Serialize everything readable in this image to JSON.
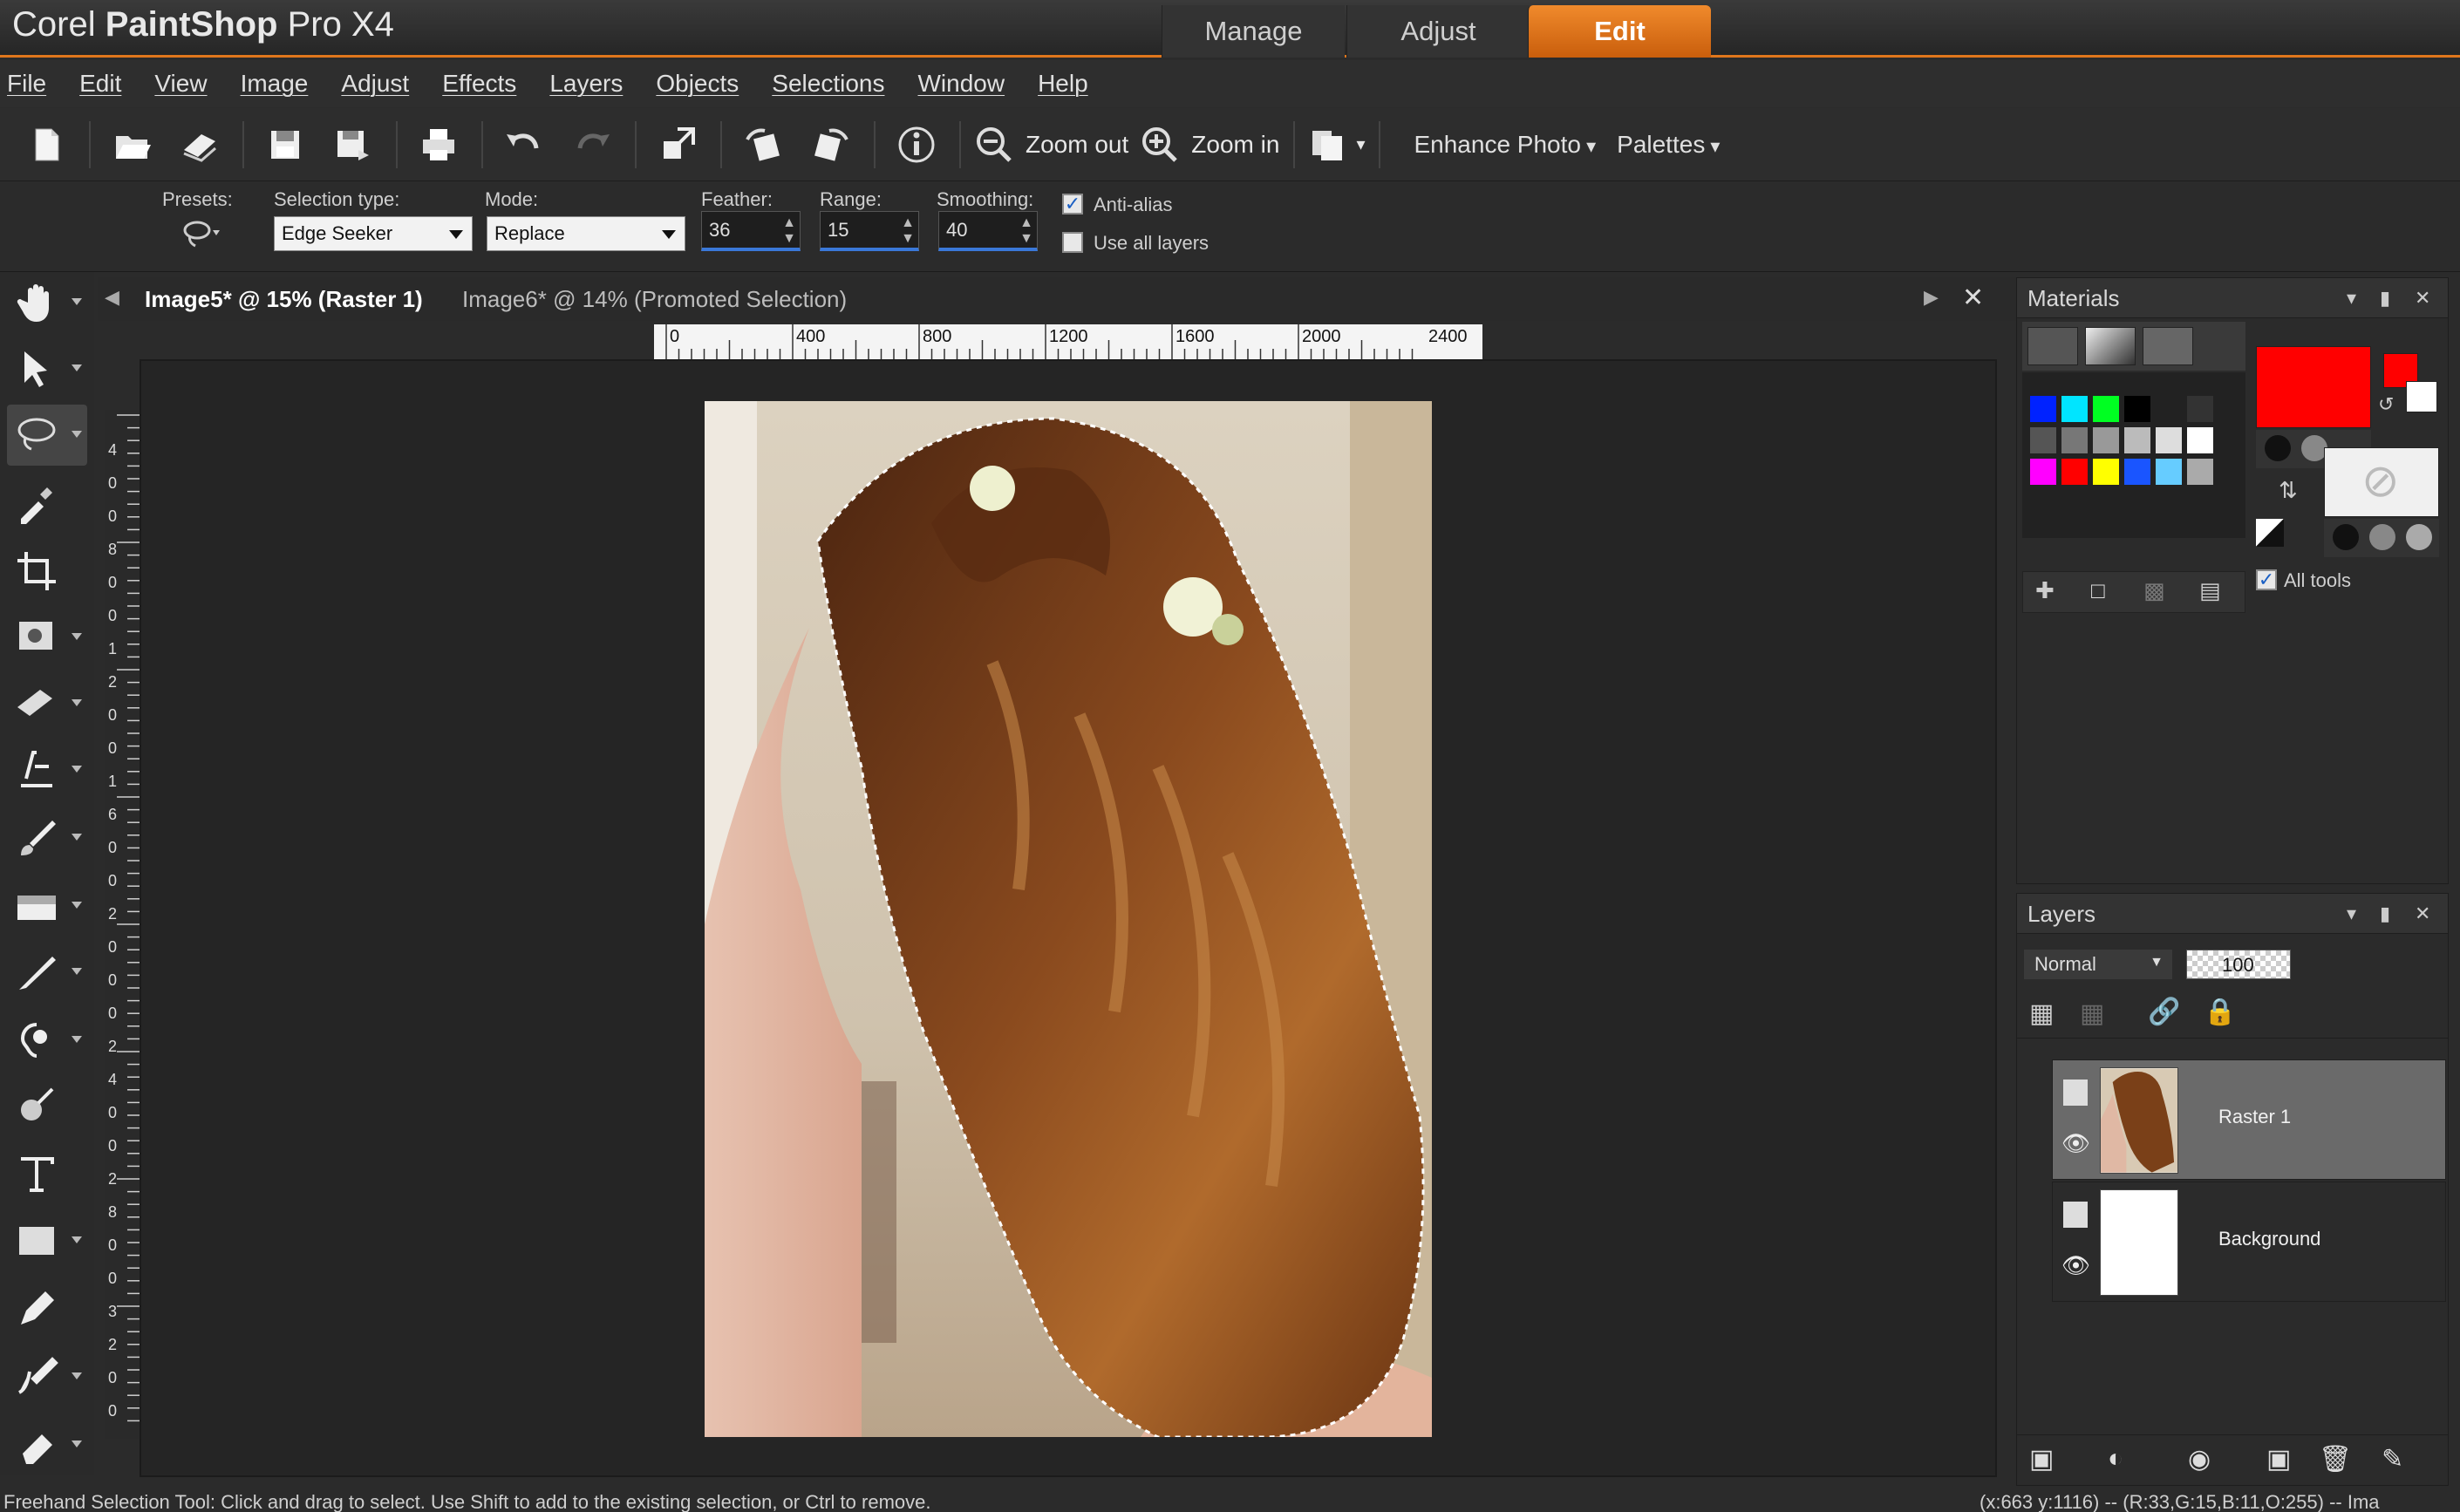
{
  "app": {
    "brand": "Corel",
    "product": "PaintShop",
    "suffix": "Pro X4"
  },
  "mode_tabs": [
    {
      "label": "Manage",
      "active": false
    },
    {
      "label": "Adjust",
      "active": false
    },
    {
      "label": "Edit",
      "active": true
    }
  ],
  "menu": [
    "File",
    "Edit",
    "View",
    "Image",
    "Adjust",
    "Effects",
    "Layers",
    "Objects",
    "Selections",
    "Window",
    "Help"
  ],
  "toolbar": {
    "icons": [
      "new-file-icon",
      "open-icon",
      "browse-icon",
      "save-icon",
      "save-as-icon",
      "print-icon",
      "undo-icon",
      "redo-icon",
      "resize-icon",
      "rotate-left-icon",
      "rotate-right-icon",
      "info-icon"
    ],
    "zoom_out": "Zoom out",
    "zoom_in": "Zoom in",
    "enhance_photo": "Enhance Photo",
    "palettes": "Palettes"
  },
  "options": {
    "presets_label": "Presets:",
    "selection_type_label": "Selection type:",
    "selection_type_value": "Edge Seeker",
    "mode_label": "Mode:",
    "mode_value": "Replace",
    "feather_label": "Feather:",
    "feather_value": "36",
    "range_label": "Range:",
    "range_value": "15",
    "smoothing_label": "Smoothing:",
    "smoothing_value": "40",
    "anti_alias_label": "Anti-alias",
    "anti_alias_checked": true,
    "use_all_layers_label": "Use all layers",
    "use_all_layers_checked": false
  },
  "documents": {
    "tabs": [
      {
        "label": "Image5* @  15% (Raster 1)",
        "active": true
      },
      {
        "label": "Image6* @  14% (Promoted Selection)",
        "active": false
      }
    ],
    "ruler_h_labels": [
      "0",
      "400",
      "800",
      "1200",
      "1600",
      "2000",
      "2400"
    ],
    "ruler_v_labels": [
      "4",
      "0",
      "0",
      "8",
      "0",
      "0",
      "1",
      "2",
      "0",
      "0",
      "1",
      "6",
      "0",
      "0",
      "2",
      "0",
      "0",
      "0",
      "2",
      "4",
      "0",
      "0",
      "2",
      "8",
      "0",
      "0",
      "3",
      "2",
      "0",
      "0"
    ]
  },
  "materials": {
    "title": "Materials",
    "foreground_color": "#ff0000",
    "background_color": "#ffffff",
    "all_tools_label": "All tools",
    "all_tools_checked": true,
    "swatches": [
      "#0022ff",
      "#00e5ff",
      "#00ff22",
      "#000000",
      "#222222",
      "#333333",
      "#555555",
      "#777777",
      "#999999",
      "#bbbbbb",
      "#dddddd",
      "#ffffff",
      "#ff00ff",
      "#ff0000",
      "#ffff00",
      "#1a55ff",
      "#66ccff",
      "#aaaaaa"
    ]
  },
  "layers": {
    "title": "Layers",
    "blend_mode": "Normal",
    "opacity": "100",
    "items": [
      {
        "name": "Raster 1",
        "selected": true
      },
      {
        "name": "Background",
        "selected": false
      }
    ]
  },
  "status": {
    "left": "Freehand Selection Tool: Click and drag to select. Use Shift to add to the existing selection, or Ctrl to remove.",
    "right": "(x:663 y:1116) -- (R:33,G:15,B:11,O:255) -- Ima"
  },
  "tools": [
    "pan-icon",
    "pick-icon",
    "freehand-selection-icon",
    "dropper-icon",
    "crop-icon",
    "red-eye-icon",
    "clone-icon",
    "scratch-remover-icon",
    "paintbrush-icon",
    "background-eraser-icon",
    "smudge-icon",
    "lighten-darken-icon",
    "dodge-icon",
    "text-icon",
    "rectangle-icon",
    "pen-icon",
    "warp-brush-icon",
    "eraser-icon"
  ]
}
